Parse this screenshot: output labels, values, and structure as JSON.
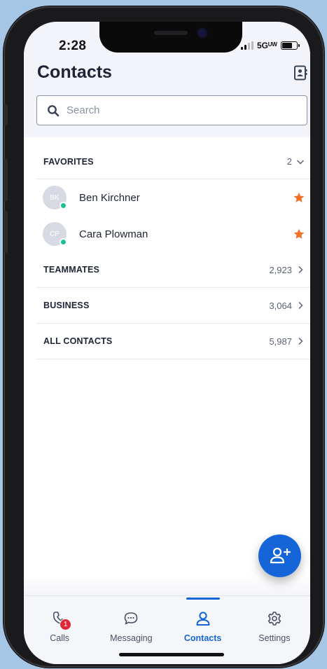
{
  "status_bar": {
    "time": "2:28",
    "network": "5Gᵁᵂ"
  },
  "header": {
    "title": "Contacts",
    "contact_book_icon": "contact-book-icon"
  },
  "search": {
    "placeholder": "Search",
    "value": ""
  },
  "favorites": {
    "label": "FAVORITES",
    "count": "2",
    "contacts": [
      {
        "initials": "BK",
        "name": "Ben Kirchner",
        "presence": "online",
        "favorite": true
      },
      {
        "initials": "CP",
        "name": "Cara Plowman",
        "presence": "online",
        "favorite": true
      }
    ]
  },
  "sections": [
    {
      "label": "TEAMMATES",
      "count": "2,923"
    },
    {
      "label": "BUSINESS",
      "count": "3,064"
    },
    {
      "label": "ALL CONTACTS",
      "count": "5,987"
    }
  ],
  "fab": {
    "icon": "add-contact-icon"
  },
  "tabs": [
    {
      "label": "Calls",
      "icon": "phone-icon",
      "badge": "1",
      "active": false
    },
    {
      "label": "Messaging",
      "icon": "chat-bubble-icon",
      "active": false
    },
    {
      "label": "Contacts",
      "icon": "person-icon",
      "active": true
    },
    {
      "label": "Settings",
      "icon": "gear-icon",
      "active": false
    }
  ],
  "colors": {
    "accent": "#1565d8",
    "favorite_star": "#f07125",
    "presence_online": "#1dbf97",
    "badge": "#e0273a",
    "text_primary": "#1d2436"
  }
}
